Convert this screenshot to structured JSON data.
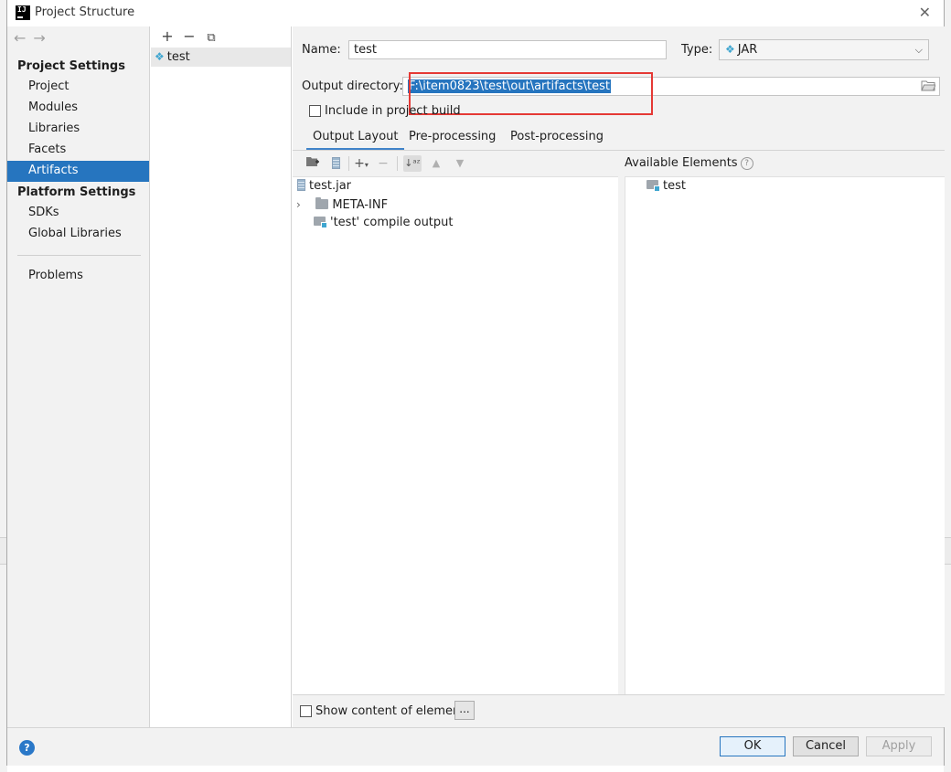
{
  "window": {
    "title": "Project Structure"
  },
  "nav": {
    "project_settings_heading": "Project Settings",
    "project_settings_items": [
      "Project",
      "Modules",
      "Libraries",
      "Facets",
      "Artifacts"
    ],
    "platform_settings_heading": "Platform Settings",
    "platform_settings_items": [
      "SDKs",
      "Global Libraries"
    ],
    "problems": "Problems",
    "selected": "Artifacts"
  },
  "artifacts_list": {
    "items": [
      "test"
    ]
  },
  "form": {
    "name_label": "Name:",
    "name_value": "test",
    "type_label": "Type:",
    "type_value": "JAR",
    "output_dir_label": "Output directory:",
    "output_dir_value": "F:\\item0823\\test\\out\\artifacts\\test",
    "include_in_build_label": "Include in project build",
    "include_in_build_checked": false
  },
  "tabs": [
    {
      "label": "Output Layout",
      "active": true
    },
    {
      "label": "Pre-processing",
      "active": false
    },
    {
      "label": "Post-processing",
      "active": false
    }
  ],
  "output_tree": {
    "root": "test.jar",
    "children": [
      "META-INF",
      "'test' compile output"
    ]
  },
  "available_elements": {
    "heading": "Available Elements",
    "items": [
      "test"
    ]
  },
  "show_content_label": "Show content of elements",
  "ellipsis_label": "...",
  "footer": {
    "ok": "OK",
    "cancel": "Cancel",
    "apply": "Apply",
    "help": "?"
  },
  "colors": {
    "selection": "#2675bf",
    "highlight_box": "#e53935",
    "artifact_accent": "#40a6d0"
  }
}
